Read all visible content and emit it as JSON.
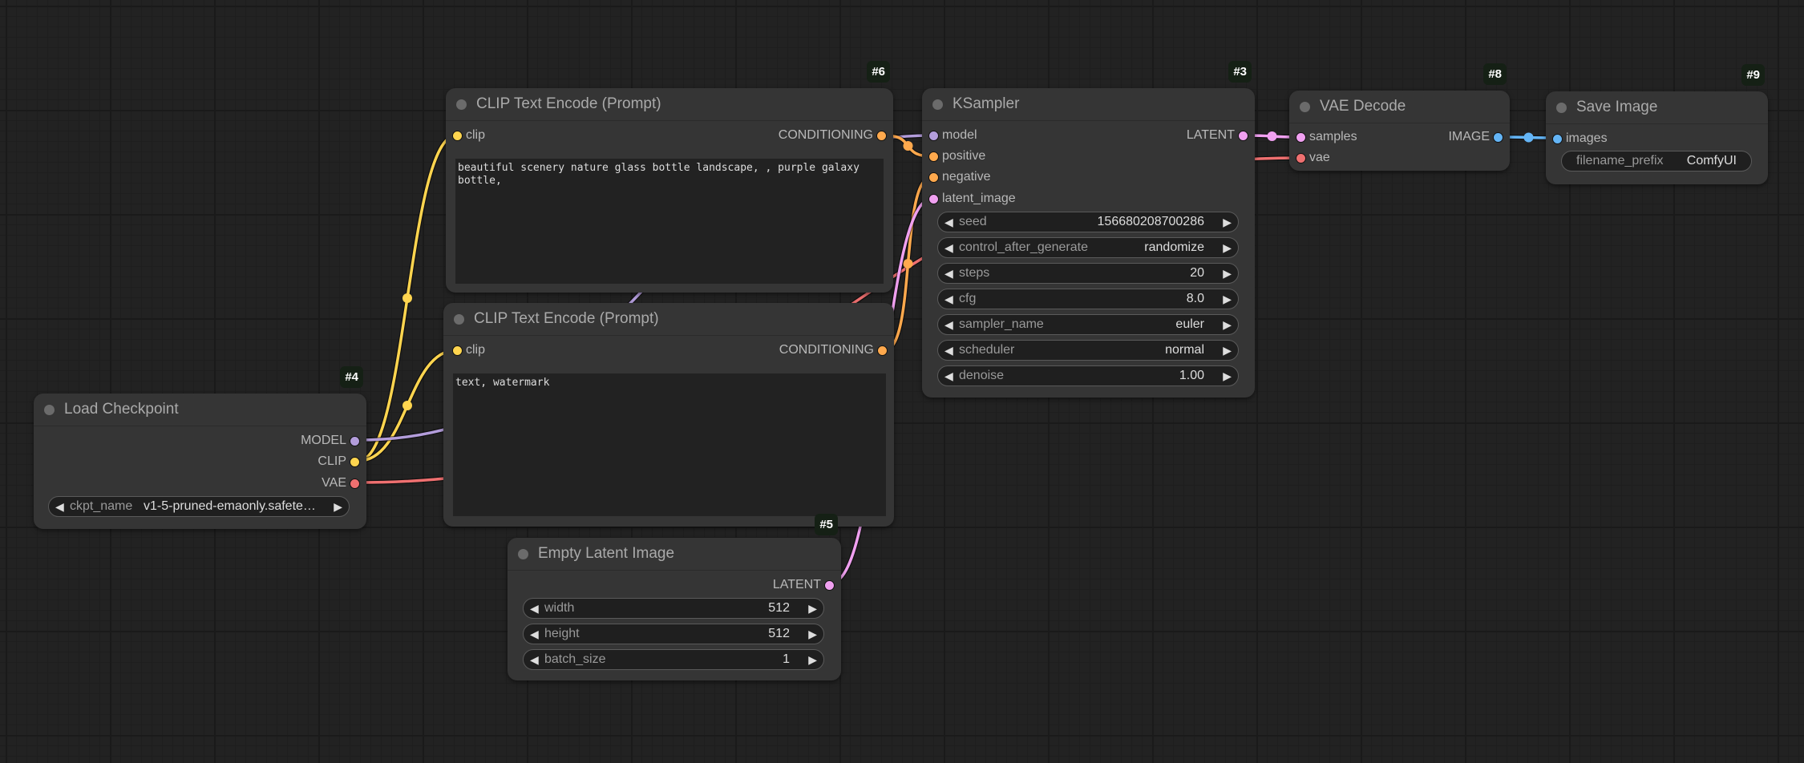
{
  "colors": {
    "model": "#b39ddb",
    "clip": "#ffd54f",
    "vae": "#ef7070",
    "conditioning": "#ffa94d",
    "latent": "#f0a0f0",
    "image": "#64b5f6"
  },
  "nodes": {
    "clip_positive": {
      "id": "#6",
      "title": "CLIP Text Encode (Prompt)",
      "input": "clip",
      "output": "CONDITIONING",
      "text": "beautiful scenery nature glass bottle landscape, , purple galaxy bottle,"
    },
    "clip_negative": {
      "title": "CLIP Text Encode (Prompt)",
      "input": "clip",
      "output": "CONDITIONING",
      "text": "text, watermark"
    },
    "ksampler": {
      "id": "#3",
      "title": "KSampler",
      "inputs": [
        "model",
        "positive",
        "negative",
        "latent_image"
      ],
      "output": "LATENT",
      "widgets": [
        {
          "label": "seed",
          "value": "156680208700286"
        },
        {
          "label": "control_after_generate",
          "value": "randomize"
        },
        {
          "label": "steps",
          "value": "20"
        },
        {
          "label": "cfg",
          "value": "8.0"
        },
        {
          "label": "sampler_name",
          "value": "euler"
        },
        {
          "label": "scheduler",
          "value": "normal"
        },
        {
          "label": "denoise",
          "value": "1.00"
        }
      ]
    },
    "vae_decode": {
      "id": "#8",
      "title": "VAE Decode",
      "inputs": [
        "samples",
        "vae"
      ],
      "output": "IMAGE"
    },
    "save_image": {
      "id": "#9",
      "title": "Save Image",
      "input": "images",
      "widget": {
        "label": "filename_prefix",
        "value": "ComfyUI"
      }
    },
    "load_checkpoint": {
      "id": "#4",
      "title": "Load Checkpoint",
      "outputs": [
        "MODEL",
        "CLIP",
        "VAE"
      ],
      "widget": {
        "label": "ckpt_name",
        "value": "v1-5-pruned-emaonly.safete…"
      }
    },
    "empty_latent": {
      "id": "#5",
      "title": "Empty Latent Image",
      "output": "LATENT",
      "widgets": [
        {
          "label": "width",
          "value": "512"
        },
        {
          "label": "height",
          "value": "512"
        },
        {
          "label": "batch_size",
          "value": "1"
        }
      ]
    }
  }
}
